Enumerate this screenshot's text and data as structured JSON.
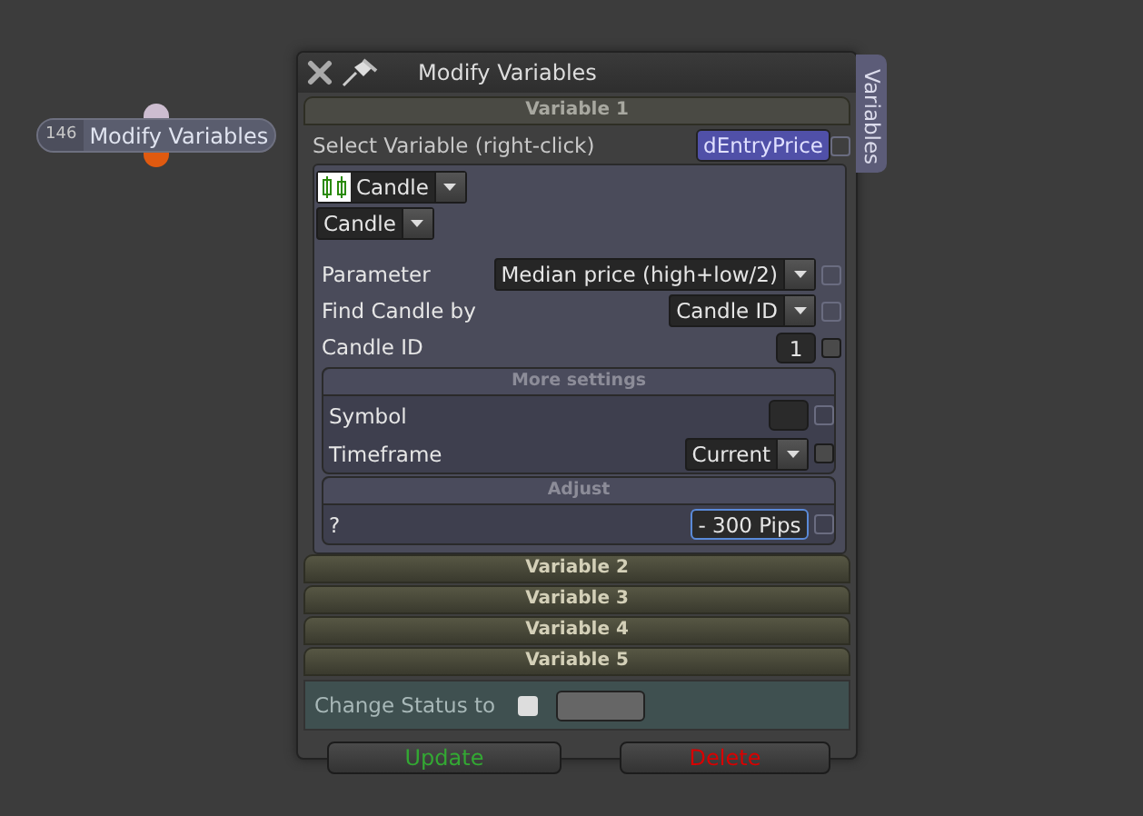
{
  "node": {
    "id": "146",
    "label": "Modify Variables"
  },
  "window": {
    "title": "Modify Variables",
    "side_tab": "Variables"
  },
  "variables": [
    {
      "title": "Variable 1",
      "expanded": true,
      "content": {
        "select_label": "Select Variable (right-click)",
        "selected_variable": "dEntryPrice",
        "select_checkbox_enabled": false,
        "type_dropdown": "Candle",
        "subtype_dropdown": "Candle",
        "rows": [
          {
            "kind": "dropdown",
            "label": "Parameter",
            "value": "Median price (high+low/2)",
            "checkbox_enabled": false
          },
          {
            "kind": "dropdown",
            "label": "Find Candle by",
            "value": "Candle ID",
            "checkbox_enabled": false
          },
          {
            "kind": "input",
            "label": "Candle ID",
            "value": "1",
            "focused": false,
            "checkbox_enabled": true
          }
        ],
        "sections": [
          {
            "title": "More settings",
            "rows": [
              {
                "kind": "input",
                "label": "Symbol",
                "focused": false,
                "checkbox_enabled": false
              },
              {
                "kind": "dropdown",
                "label": "Timeframe",
                "value": "Current",
                "checkbox_enabled": true
              }
            ]
          },
          {
            "title": "Adjust",
            "rows": [
              {
                "kind": "input",
                "label": "?",
                "value": "- 300 Pips",
                "focused": true,
                "checkbox_enabled": false
              }
            ]
          }
        ]
      }
    },
    {
      "title": "Variable 2",
      "expanded": false
    },
    {
      "title": "Variable 3",
      "expanded": false
    },
    {
      "title": "Variable 4",
      "expanded": false
    },
    {
      "title": "Variable 5",
      "expanded": false
    }
  ],
  "status": {
    "label": "Change Status to",
    "checked": false
  },
  "buttons": [
    {
      "label": "Update",
      "color": "#33a833"
    },
    {
      "label": "Delete",
      "color": "#d80000"
    }
  ]
}
